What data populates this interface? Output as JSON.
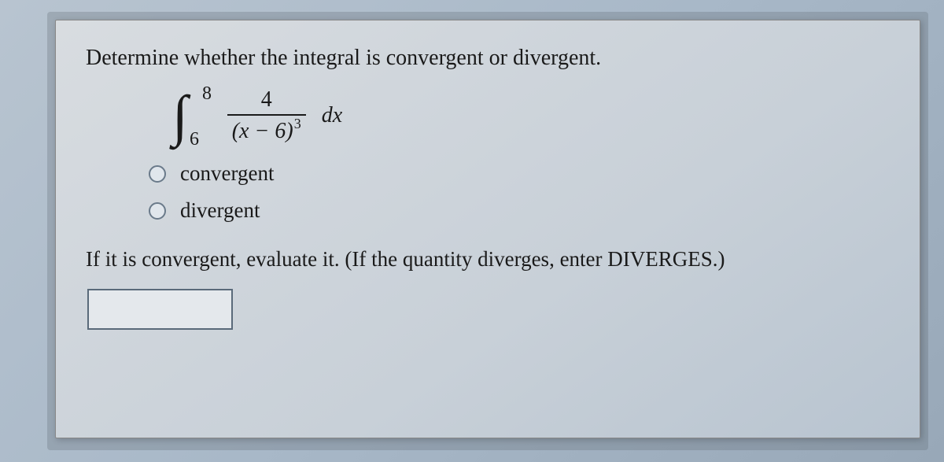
{
  "question": {
    "prompt": "Determine whether the integral is convergent or divergent.",
    "integral": {
      "lower_limit": "6",
      "upper_limit": "8",
      "numerator": "4",
      "denominator_base": "(x − 6)",
      "denominator_exp": "3",
      "differential": "dx"
    },
    "options": {
      "opt1": "convergent",
      "opt2": "divergent"
    },
    "followup": "If it is convergent, evaluate it. (If the quantity diverges, enter DIVERGES.)",
    "answer_value": ""
  }
}
